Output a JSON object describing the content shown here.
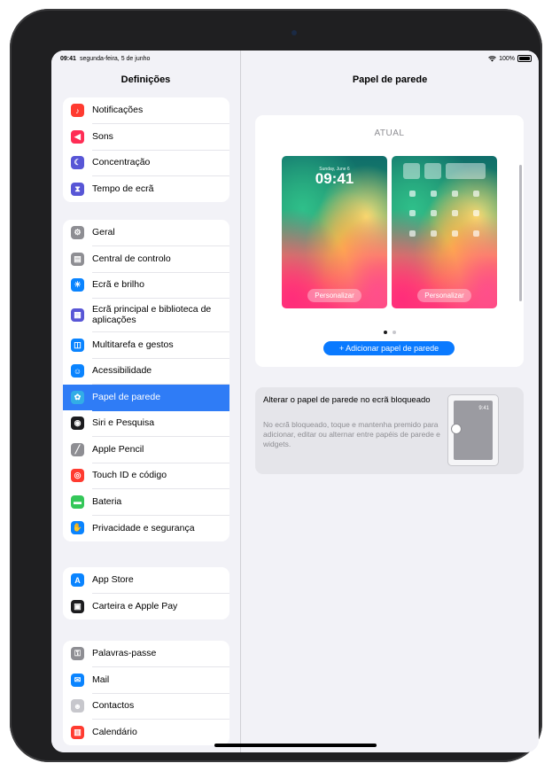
{
  "status_bar": {
    "time": "09:41",
    "date": "segunda-feira, 5 de junho",
    "battery": "100%"
  },
  "sidebar": {
    "title": "Definições",
    "groups": [
      {
        "items": [
          {
            "label": "Notificações",
            "icon": "bell-icon",
            "color": "#ff3b30"
          },
          {
            "label": "Sons",
            "icon": "speaker-icon",
            "color": "#ff2d55"
          },
          {
            "label": "Concentração",
            "icon": "moon-icon",
            "color": "#5856d6"
          },
          {
            "label": "Tempo de ecrã",
            "icon": "hourglass-icon",
            "color": "#5856d6"
          }
        ]
      },
      {
        "items": [
          {
            "label": "Geral",
            "icon": "gear-icon",
            "color": "#8e8e93"
          },
          {
            "label": "Central de controlo",
            "icon": "switches-icon",
            "color": "#8e8e93"
          },
          {
            "label": "Ecrã e brilho",
            "icon": "sun-icon",
            "color": "#0a84ff"
          },
          {
            "label": "Ecrã principal e biblioteca de aplicações",
            "icon": "app-grid-icon",
            "color": "#5856d6"
          },
          {
            "label": "Multitarefa e gestos",
            "icon": "multitask-icon",
            "color": "#0a84ff"
          },
          {
            "label": "Acessibilidade",
            "icon": "accessibility-icon",
            "color": "#0a84ff"
          },
          {
            "label": "Papel de parede",
            "icon": "flower-icon",
            "color": "#32ade6",
            "selected": true
          },
          {
            "label": "Siri e Pesquisa",
            "icon": "siri-icon",
            "color": "#1c1c1e"
          },
          {
            "label": "Apple Pencil",
            "icon": "pencil-icon",
            "color": "#8e8e93"
          },
          {
            "label": "Touch ID e código",
            "icon": "fingerprint-icon",
            "color": "#ff3b30"
          },
          {
            "label": "Bateria",
            "icon": "battery-icon",
            "color": "#34c759"
          },
          {
            "label": "Privacidade e segurança",
            "icon": "hand-icon",
            "color": "#0a84ff"
          }
        ]
      },
      {
        "items": [
          {
            "label": "App Store",
            "icon": "app-store-icon",
            "color": "#0a84ff"
          },
          {
            "label": "Carteira e Apple Pay",
            "icon": "wallet-icon",
            "color": "#1c1c1e"
          }
        ]
      },
      {
        "items": [
          {
            "label": "Palavras-passe",
            "icon": "key-icon",
            "color": "#8e8e93"
          },
          {
            "label": "Mail",
            "icon": "mail-icon",
            "color": "#0a84ff"
          },
          {
            "label": "Contactos",
            "icon": "contacts-icon",
            "color": "#c7c7cc"
          },
          {
            "label": "Calendário",
            "icon": "calendar-icon",
            "color": "#ff3b30"
          }
        ]
      }
    ]
  },
  "detail": {
    "title": "Papel de parede",
    "current_label": "ATUAL",
    "lock_preview": {
      "date": "Sunday, June 6",
      "time": "09:41",
      "customize": "Personalizar"
    },
    "home_preview": {
      "customize": "Personalizar"
    },
    "add_button": "+ Adicionar papel de parede",
    "tip": {
      "title": "Alterar o papel de parede no ecrã bloqueado",
      "description": "No ecrã bloqueado, toque e mantenha premido para adicionar, editar ou alternar entre papéis de parede e widgets.",
      "mini_time": "9:41"
    }
  }
}
